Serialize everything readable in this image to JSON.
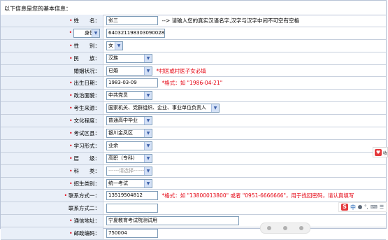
{
  "header": {
    "title": "以下信息是您的基本信息："
  },
  "rows": {
    "name": {
      "label": "姓　　名：",
      "value": "张三",
      "note": "--> 请输入您的真实汉语名字,汉字与汉字中间不可空有空格"
    },
    "id_type": {
      "select": "身份证",
      "value": "640321198303090028"
    },
    "gender": {
      "label": "性　　别：",
      "value": "女"
    },
    "ethnicity": {
      "label": "民　　族：",
      "value": "汉族"
    },
    "marital": {
      "label": "婚姻状况：",
      "value": "已婚",
      "note": "*村医或村医子女必填"
    },
    "birth": {
      "label": "出生日期：",
      "value": "1983-03-09",
      "note": "*格式：如 \"1986-04-21\""
    },
    "political": {
      "label": "政治面貌：",
      "value": "中共党员"
    },
    "source": {
      "label": "考生来源：",
      "value": "国家机关、党群组织、企业、事业单位负责人"
    },
    "education": {
      "label": "文化程度：",
      "value": "普通高中毕业"
    },
    "exam_area": {
      "label": "考试区县：",
      "value": "银川金凤区"
    },
    "study_form": {
      "label": "学习形式：",
      "value": "业余"
    },
    "level": {
      "label": "层　　级：",
      "value": "高职（专科）"
    },
    "subject": {
      "label": "科　　类：",
      "value": "------请选择------"
    },
    "category": {
      "label": "招生类别：",
      "value": "统一考试"
    },
    "contact1": {
      "label": "联系方式一：",
      "value": "13519504812",
      "note": "*格式：如 \"13800013800\" 或者 \"0951-6666666\"，用于找回密码，请认真填写"
    },
    "contact2": {
      "label": "联系方式二：",
      "value": ""
    },
    "address": {
      "label": "通信地址：",
      "value": "宁夏教育考试院测试用"
    },
    "postcode": {
      "label": "邮政编码：",
      "value": "750004"
    }
  },
  "widgets": {
    "side_tab": "收",
    "ime_s": "S",
    "ime_zh": "中"
  },
  "colors": {
    "label_bg": "#e9eff8",
    "required": "#e4000f",
    "border": "#c6cfdd"
  }
}
